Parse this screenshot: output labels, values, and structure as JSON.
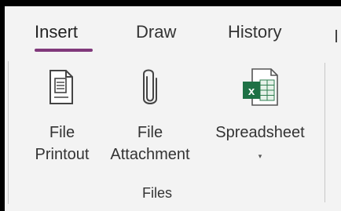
{
  "ribbon": {
    "tabs": [
      {
        "label": "Insert",
        "active": true
      },
      {
        "label": "Draw",
        "active": false
      },
      {
        "label": "History",
        "active": false
      }
    ],
    "accent_color": "#80397b",
    "group": {
      "label": "Files",
      "buttons": [
        {
          "line1": "File",
          "line2": "Printout",
          "icon": "file-printout-icon"
        },
        {
          "line1": "File",
          "line2": "Attachment",
          "icon": "paperclip-icon"
        },
        {
          "line1": "Spreadsheet",
          "arrow": "▾",
          "icon": "excel-spreadsheet-icon"
        }
      ]
    }
  }
}
